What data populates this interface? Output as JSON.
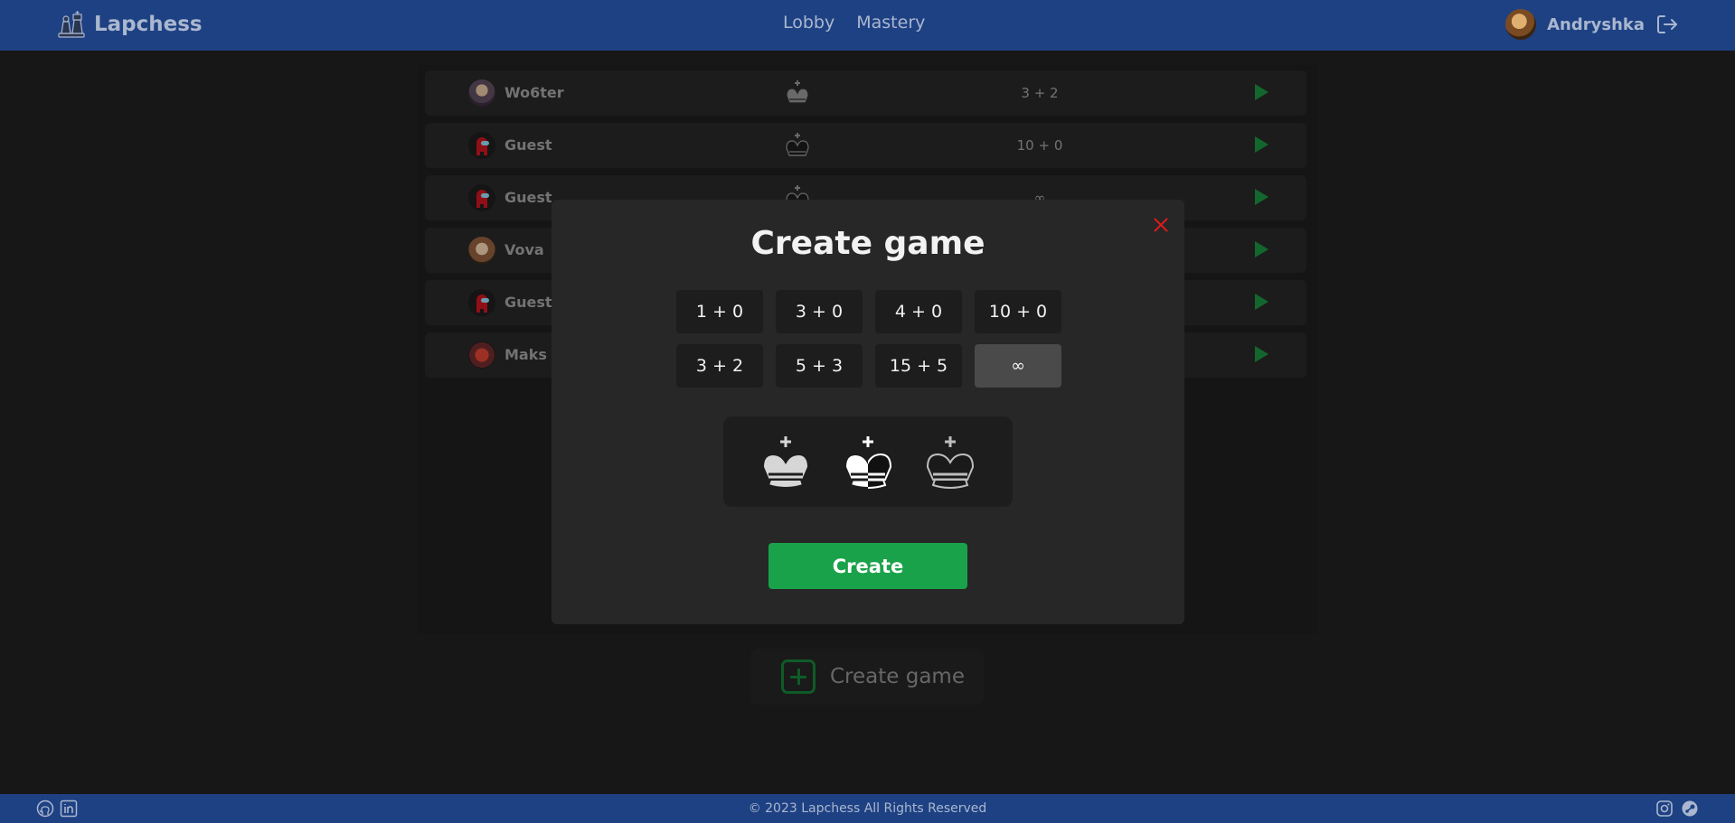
{
  "header": {
    "logo_text": "Lapchess",
    "nav": [
      "Lobby",
      "Mastery"
    ],
    "username": "Andryshka"
  },
  "lobby": {
    "rows": [
      {
        "name": "Wo6ter",
        "piece": "white-king",
        "time": "3 + 2"
      },
      {
        "name": "Guest",
        "piece": "black-king",
        "time": "10 + 0"
      },
      {
        "name": "Guest",
        "piece": "black-king",
        "time": "∞"
      },
      {
        "name": "Vova",
        "piece": "",
        "time": ""
      },
      {
        "name": "Guest",
        "piece": "",
        "time": ""
      },
      {
        "name": "Maks",
        "piece": "",
        "time": ""
      }
    ],
    "create_label": "Create game"
  },
  "modal": {
    "title": "Create game",
    "time_controls": [
      "1 + 0",
      "3 + 0",
      "4 + 0",
      "10 + 0",
      "3 + 2",
      "5 + 3",
      "15 + 5",
      "∞"
    ],
    "selected_time_control": "∞",
    "sides": [
      "white",
      "random",
      "black"
    ],
    "create_button": "Create"
  },
  "footer": {
    "copyright": "© 2023 Lapchess All Rights Reserved"
  },
  "colors": {
    "header_bg": "#1e4183",
    "accent_green": "#1aa24a",
    "close_red": "#e01b1b"
  }
}
